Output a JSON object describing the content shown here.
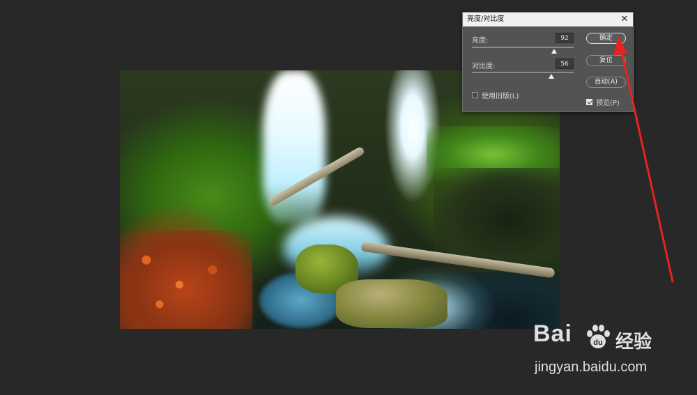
{
  "dialog": {
    "title": "亮度/对比度",
    "brightness_label": "亮度:",
    "brightness_value": "92",
    "brightness_level": 0.81,
    "contrast_label": "对比度:",
    "contrast_value": "56",
    "contrast_level": 0.78,
    "use_legacy_label": "使用旧版(L)",
    "use_legacy_checked": false,
    "ok_label": "确定",
    "reset_label": "复位",
    "auto_label": "自动(A)",
    "preview_label": "预览(P)",
    "preview_checked": true
  },
  "watermark": {
    "brand": "Bai",
    "brand_suffix": "经验",
    "url": "jingyan.baidu.com"
  },
  "colors": {
    "background": "#282828",
    "dialog_bg": "#535353",
    "annotation_arrow": "#e8231f"
  }
}
